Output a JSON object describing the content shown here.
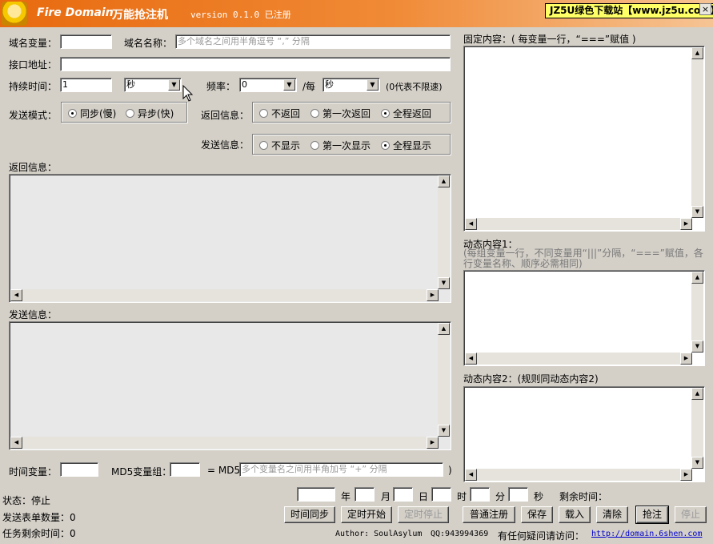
{
  "window": {
    "title": "Fire Domain",
    "title_cn": "万能抢注机",
    "version": "version 0.1.0 已注册",
    "brand_tag": "JZ5U绿色下载站【www.jz5u.com】",
    "close": "×"
  },
  "form": {
    "domain_var_label": "域名变量：",
    "domain_var_value": "",
    "domain_name_label": "域名名称：",
    "domain_name_placeholder": "多个域名之间用半角逗号 “,” 分隔",
    "api_label": "接口地址：",
    "api_value": "",
    "duration_label": "持续时间：",
    "duration_value": "1",
    "duration_unit": "秒",
    "freq_label": "频率：",
    "freq_value": "0",
    "per_label": "/每",
    "per_unit": "秒",
    "unlimited_note": "(0代表不限速)",
    "send_mode_label": "发送模式：",
    "send_mode_options": [
      "同步(慢)",
      "异步(快)"
    ],
    "return_info_label": "返回信息：",
    "return_info_options": [
      "不返回",
      "第一次返回",
      "全程返回"
    ],
    "send_info_label": "发送信息：",
    "send_info_options": [
      "不显示",
      "第一次显示",
      "全程显示"
    ]
  },
  "panels": {
    "return_log_label": "返回信息：",
    "send_log_label": "发送信息：",
    "time_var_label": "时间变量：",
    "md5_group_label": "MD5变量组：",
    "md5_eq": "= MD5 (",
    "md5_placeholder": "多个变量名之间用半角加号 “+” 分隔",
    "md5_close": ")"
  },
  "right": {
    "fixed_label": "固定内容：( 每变量一行，“===”赋值 )",
    "dyn1_label": "动态内容1：",
    "dyn1_hint": "(每组变量一行，不同变量用“|||”分隔，“===”赋值，各行变量名称、顺序必需相同)",
    "dyn2_label": "动态内容2：(规则同动态内容2)"
  },
  "schedule": {
    "year_label": "年",
    "month_label": "月",
    "day_label": "日",
    "hour_label": "时",
    "minute_label": "分",
    "second_label": "秒",
    "remaining_label": "剩余时间："
  },
  "status": {
    "state_label": "状态：停止",
    "sent_count_label": "发送表单数量：0",
    "task_remaining_label": "任务剩余时间：0"
  },
  "buttons": {
    "time_sync": "时间同步",
    "timer_start": "定时开始",
    "timer_stop": "定时停止",
    "normal_register": "普通注册",
    "save": "保存",
    "load": "载入",
    "clear": "清除",
    "snipe": "抢注",
    "stop": "停止"
  },
  "footer": {
    "author": "Author: SoulAsylum",
    "qq": "QQ:943994369",
    "question": "有任何疑问请访问：",
    "link": "http://domain.6shen.com"
  }
}
